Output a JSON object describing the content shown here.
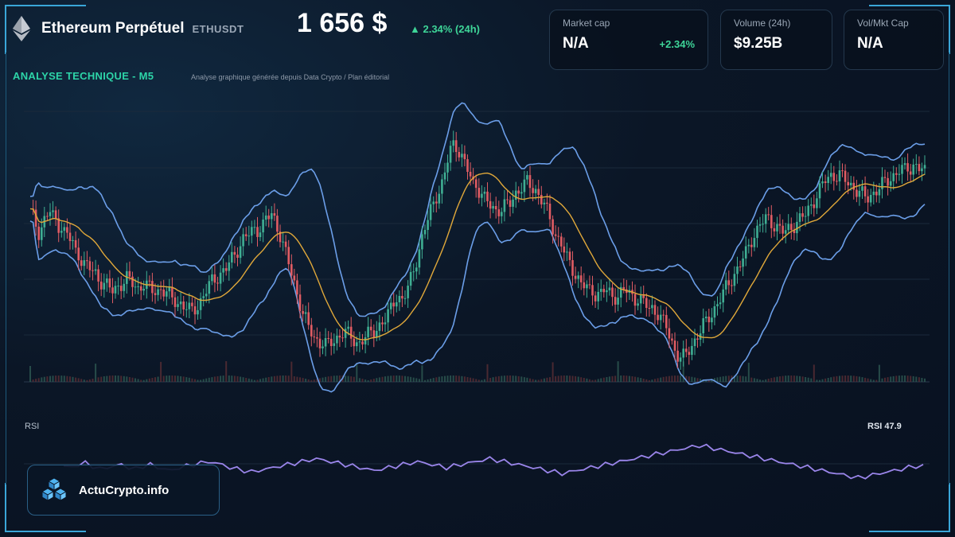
{
  "header": {
    "title": "Ethereum Perpétuel",
    "ticker": "ETHUSDT",
    "price": "1 656 $",
    "change": "▲ 2.34% (24h)",
    "icon": "ethereum-icon"
  },
  "cards": [
    {
      "label": "Market cap",
      "value": "N/A",
      "delta": "+2.34%"
    },
    {
      "label": "Volume (24h)",
      "value": "$9.25B",
      "delta": ""
    },
    {
      "label": "Vol/Mkt Cap",
      "value": "N/A",
      "delta": ""
    }
  ],
  "section": {
    "title": "ANALYSE TECHNIQUE - M5",
    "subtitle": "Analyse graphique générée depuis Data Crypto / Plan éditorial"
  },
  "rsi": {
    "label": "RSI",
    "value_text": "RSI 47.9"
  },
  "brand": {
    "name": "ActuCrypto.info",
    "icon": "cubes-logo-icon"
  },
  "colors": {
    "up": "#3fae93",
    "down": "#e05c63",
    "bollinger": "#6b9ee8",
    "ma": "#e0a83a",
    "rsi": "#9a85ea",
    "accent": "#2dd4a8",
    "frame": "#3aa6d8"
  },
  "chart_data": [
    {
      "type": "candlestick",
      "title": "ANALYSE TECHNIQUE - M5",
      "indicators": [
        "bollinger-bands",
        "moving-average",
        "volume"
      ],
      "grid": true,
      "closes": [
        63,
        61,
        58,
        55,
        57,
        60,
        62,
        63,
        61,
        60,
        58,
        57,
        55,
        54,
        52,
        50,
        47,
        46,
        44,
        42,
        41,
        40,
        39,
        38,
        36,
        35,
        34,
        33,
        32,
        31,
        32,
        33,
        34,
        35,
        36,
        35,
        34,
        33,
        32,
        33,
        34,
        33,
        32,
        31,
        31,
        31,
        32,
        31,
        30,
        29,
        28,
        27,
        26,
        26,
        25,
        24,
        23,
        23,
        24,
        25,
        27,
        29,
        31,
        33,
        35,
        36,
        37,
        38,
        39,
        40,
        42,
        44,
        46,
        48,
        50,
        52,
        53,
        54,
        55,
        56,
        56,
        57,
        58,
        60,
        61,
        62,
        60,
        57,
        54,
        50,
        46,
        42,
        38,
        34,
        30,
        26,
        22,
        19,
        16,
        14,
        12,
        11,
        10,
        10,
        9,
        9,
        10,
        11,
        12,
        13,
        14,
        14,
        13,
        12,
        11,
        10,
        10,
        11,
        12,
        13,
        14,
        15,
        16,
        17,
        18,
        19,
        21,
        24,
        27,
        29,
        28,
        27,
        29,
        32,
        36,
        40,
        44,
        48,
        52,
        56,
        60,
        64,
        67,
        70,
        72,
        74,
        78,
        84,
        89,
        91,
        90,
        88,
        85,
        82,
        80,
        78,
        75,
        74,
        72,
        70,
        68,
        67,
        66,
        65,
        64,
        64,
        64,
        65,
        66,
        67,
        69,
        71,
        72,
        73,
        74,
        75,
        74,
        73,
        72,
        70,
        68,
        66,
        63,
        60,
        57,
        54,
        52,
        50,
        47,
        44,
        42,
        40,
        38,
        36,
        34,
        33,
        32,
        31,
        31,
        30,
        30,
        30,
        31,
        31,
        30,
        29,
        29,
        29,
        30,
        31,
        31,
        30,
        29,
        28,
        28,
        27,
        26,
        25,
        24,
        24,
        23,
        22,
        20,
        18,
        16,
        13,
        10,
        7,
        5,
        4,
        4,
        5,
        7,
        9,
        11,
        13,
        15,
        17,
        18,
        20,
        22,
        24,
        26,
        28,
        30,
        32,
        34,
        36,
        38,
        40,
        42,
        44,
        46,
        49,
        52,
        54,
        56,
        58,
        59,
        60,
        60,
        59,
        58,
        57,
        56,
        55,
        55,
        56,
        57,
        58,
        59,
        60,
        61,
        62,
        64,
        66,
        68,
        70,
        72,
        74,
        76,
        77,
        78,
        78,
        78,
        78,
        77,
        76,
        75,
        74,
        73,
        72,
        71,
        70,
        69,
        69,
        70,
        71,
        72,
        73,
        74,
        75,
        76,
        77,
        78,
        79,
        80,
        80,
        80,
        81,
        81,
        82,
        82,
        81,
        80,
        79
      ],
      "rsi": [
        48,
        47,
        49,
        50,
        48,
        46,
        47,
        48,
        49,
        47,
        46,
        48,
        49,
        47,
        46,
        45,
        47,
        48,
        49,
        50,
        51,
        50,
        49,
        47,
        46,
        45,
        44,
        45,
        46,
        47,
        48,
        49,
        50,
        51,
        52,
        53,
        52,
        51,
        50,
        49,
        48,
        47,
        46,
        45,
        46,
        47,
        48,
        49,
        50,
        51,
        50,
        49,
        48,
        47,
        48,
        49,
        50,
        51,
        52,
        53,
        52,
        51,
        50,
        49,
        48,
        47,
        46,
        45,
        44,
        43,
        44,
        45,
        46,
        47,
        48,
        49,
        50,
        51,
        52,
        53,
        54,
        55,
        56,
        57,
        58,
        59,
        60,
        61,
        62,
        61,
        60,
        59,
        58,
        57,
        56,
        55,
        54,
        53,
        52,
        51,
        50,
        49,
        48,
        47,
        46,
        45,
        44,
        43,
        42,
        41,
        40,
        41,
        42,
        43,
        44,
        45,
        46,
        47,
        48,
        47.9
      ]
    }
  ]
}
